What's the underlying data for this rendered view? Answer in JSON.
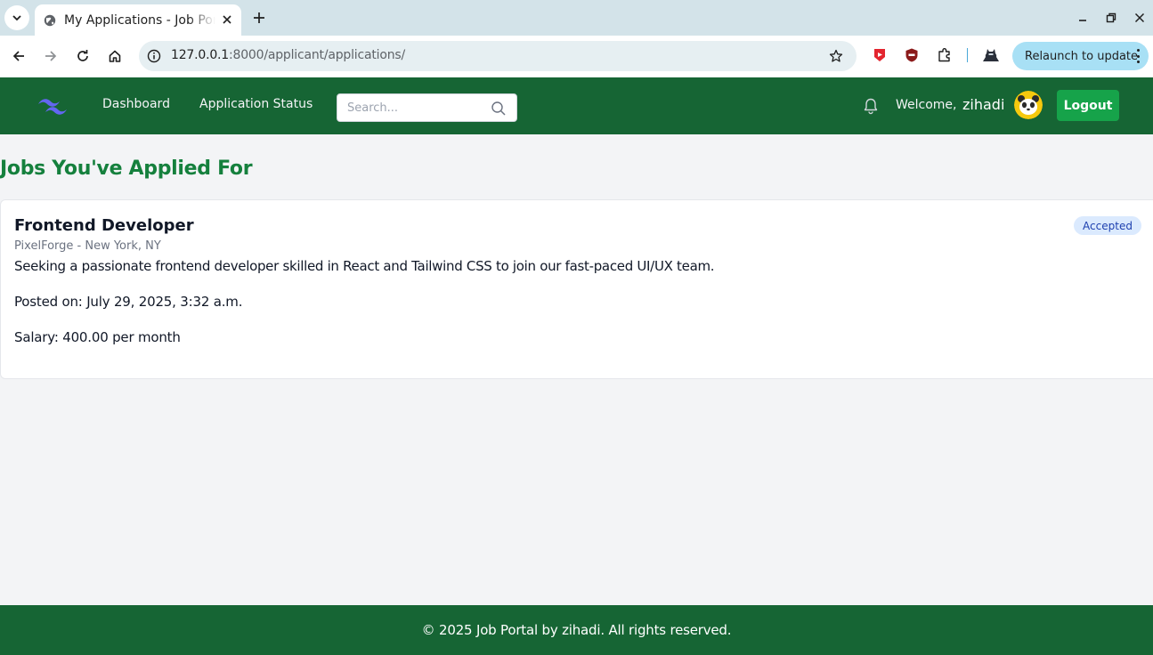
{
  "browser": {
    "tab_title": "My Applications - Job Portal",
    "url_host": "127.0.0.1",
    "url_rest": ":8000/applicant/applications/",
    "relaunch_label": "Relaunch to update",
    "icons": [
      "tab-search-icon",
      "globe-icon",
      "close-icon",
      "plus-icon",
      "minimize-icon",
      "restore-icon",
      "window-close-icon",
      "back-icon",
      "forward-icon",
      "reload-icon",
      "home-icon",
      "info-icon",
      "star-icon",
      "extension-puzzle-icon",
      "profile-icon",
      "kebab-menu-icon"
    ]
  },
  "navbar": {
    "links": [
      "Dashboard",
      "Application Status"
    ],
    "search_placeholder": "Search...",
    "welcome_label": "Welcome,",
    "username": "zihadi",
    "logout_label": "Logout",
    "brand_color": "#166534",
    "button_color": "#16a34a"
  },
  "main": {
    "title": "Jobs You've Applied For",
    "applications": [
      {
        "title": "Frontend Developer",
        "company_location": "PixelForge - New York, NY",
        "description": "Seeking a passionate frontend developer skilled in React and Tailwind CSS to join our fast-paced UI/UX team.",
        "posted": "Posted on: July 29, 2025, 3:32 a.m.",
        "salary": "Salary: 400.00 per month",
        "status": "Accepted"
      }
    ]
  },
  "footer": {
    "text": "© 2025 Job Portal by zihadi. All rights reserved."
  }
}
